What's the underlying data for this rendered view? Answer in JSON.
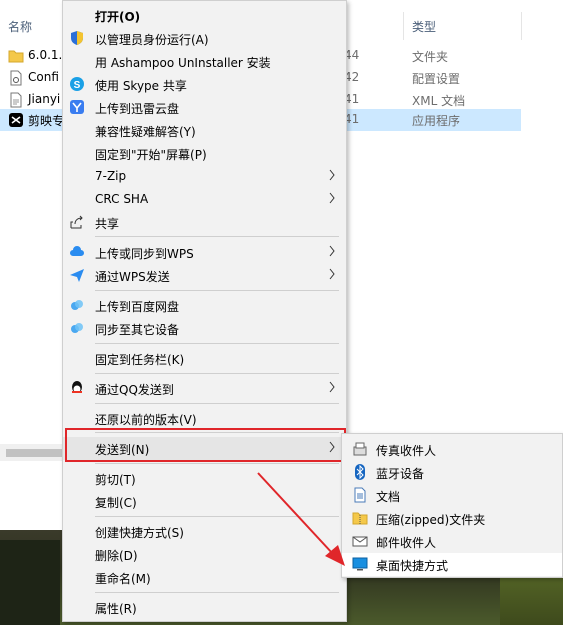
{
  "explorer": {
    "columns": {
      "name": "名称",
      "type": "类型"
    },
    "files": [
      {
        "name": "6.0.1.",
        "time": "44",
        "type": "文件夹",
        "icon": "folder-icon"
      },
      {
        "name": "Confi",
        "time": "42",
        "type": "配置设置",
        "icon": "config-file-icon"
      },
      {
        "name": "Jianyi",
        "time": "41",
        "type": "XML 文档",
        "icon": "xml-file-icon"
      },
      {
        "name": "剪映专",
        "time": "41",
        "type": "应用程序",
        "icon": "capcut-app-icon",
        "selected": true
      }
    ]
  },
  "context_menu": {
    "items": [
      {
        "label": "打开(O)",
        "icon": "",
        "bold": true
      },
      {
        "label": "以管理员身份运行(A)",
        "icon": "uac-shield-icon"
      },
      {
        "label": "用 Ashampoo UnInstaller 安装",
        "icon": ""
      },
      {
        "label": "使用 Skype 共享",
        "icon": "skype-icon"
      },
      {
        "label": "上传到迅雷云盘",
        "icon": "xunlei-icon"
      },
      {
        "label": "兼容性疑难解答(Y)",
        "icon": ""
      },
      {
        "label": "固定到\"开始\"屏幕(P)",
        "icon": ""
      },
      {
        "label": "7-Zip",
        "icon": "",
        "submenu": true
      },
      {
        "label": "CRC SHA",
        "icon": "",
        "submenu": true
      },
      {
        "label": "共享",
        "icon": "share-icon"
      },
      {
        "label": "上传或同步到WPS",
        "icon": "wps-cloud-icon",
        "submenu": true
      },
      {
        "label": "通过WPS发送",
        "icon": "wps-send-icon",
        "submenu": true
      },
      {
        "label": "上传到百度网盘",
        "icon": "baidu-netdisk-icon"
      },
      {
        "label": "同步至其它设备",
        "icon": "baidu-sync-icon"
      },
      {
        "label": "固定到任务栏(K)",
        "icon": ""
      },
      {
        "label": "通过QQ发送到",
        "icon": "qq-icon",
        "submenu": true
      },
      {
        "label": "还原以前的版本(V)",
        "icon": ""
      },
      {
        "label": "发送到(N)",
        "icon": "",
        "submenu": true,
        "highlighted": true
      },
      {
        "label": "剪切(T)",
        "icon": ""
      },
      {
        "label": "复制(C)",
        "icon": ""
      },
      {
        "label": "创建快捷方式(S)",
        "icon": ""
      },
      {
        "label": "删除(D)",
        "icon": ""
      },
      {
        "label": "重命名(M)",
        "icon": ""
      },
      {
        "label": "属性(R)",
        "icon": ""
      }
    ]
  },
  "send_to_submenu": {
    "items": [
      {
        "label": "传真收件人",
        "icon": "fax-icon"
      },
      {
        "label": "蓝牙设备",
        "icon": "bluetooth-icon"
      },
      {
        "label": "文档",
        "icon": "documents-icon"
      },
      {
        "label": "压缩(zipped)文件夹",
        "icon": "zip-folder-icon"
      },
      {
        "label": "邮件收件人",
        "icon": "mail-icon"
      },
      {
        "label": "桌面快捷方式",
        "icon": "desktop-icon",
        "highlighted": true
      }
    ]
  },
  "colors": {
    "menu_bg": "#f2f2f2",
    "selection": "#cce8ff",
    "annotation_red": "#e0262a"
  }
}
